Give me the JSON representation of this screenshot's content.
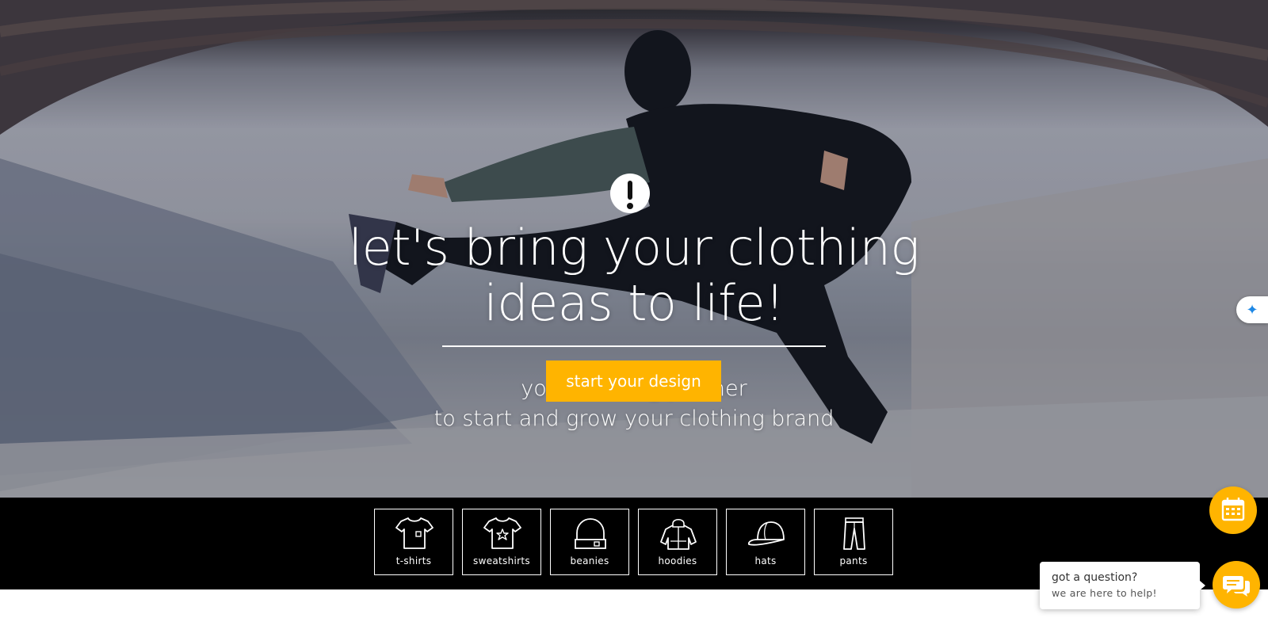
{
  "hero": {
    "headline_line1": "let's bring your clothing",
    "headline_line2": "ideas to life!",
    "subtext_line1": "your clothing partner",
    "subtext_line2": "to start and grow your clothing brand",
    "cta_label": "start your design",
    "accent_color": "#ffb400"
  },
  "categories": [
    {
      "label": "t-shirts",
      "icon": "t-shirt-icon"
    },
    {
      "label": "sweatshirts",
      "icon": "sweatshirt-icon"
    },
    {
      "label": "beanies",
      "icon": "beanie-icon"
    },
    {
      "label": "hoodies",
      "icon": "hoodie-icon"
    },
    {
      "label": "hats",
      "icon": "cap-icon"
    },
    {
      "label": "pants",
      "icon": "pants-icon"
    }
  ],
  "widgets": {
    "chat_question": "got a question?",
    "chat_help": "we are here to help!",
    "calendar_icon": "calendar-icon",
    "chat_icon": "chat-bubble-icon",
    "side_tab_icon": "water-drop-icon"
  }
}
